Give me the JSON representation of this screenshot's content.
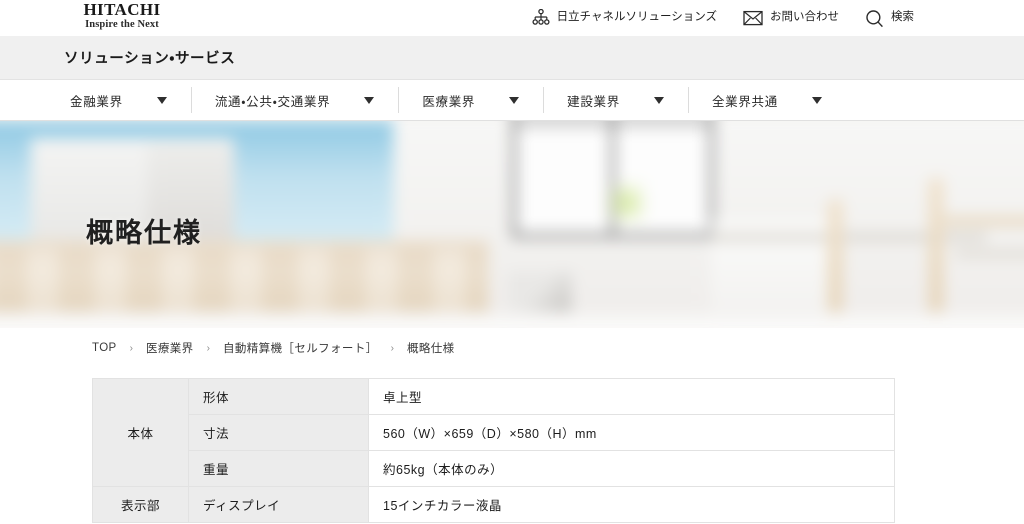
{
  "header": {
    "logo_main": "HITACHI",
    "logo_tagline": "Inspire the Next",
    "utilities": [
      {
        "icon": "sitemap-icon",
        "label": "日立チャネルソリューションズ"
      },
      {
        "icon": "mail-icon",
        "label": "お問い合わせ"
      },
      {
        "icon": "search-icon",
        "label": "検索"
      }
    ]
  },
  "title_band": {
    "title": "ソリューション・サービス"
  },
  "category_nav": {
    "items": [
      {
        "label": "金融業界"
      },
      {
        "label": "流通・公共・交通業界"
      },
      {
        "label": "医療業界"
      },
      {
        "label": "建設業界"
      },
      {
        "label": "全業界共通"
      }
    ]
  },
  "hero": {
    "title": "概略仕様"
  },
  "breadcrumb": {
    "separator": "›",
    "items": [
      {
        "label": "TOP"
      },
      {
        "label": "医療業界"
      },
      {
        "label": "自動精算機［セルフォート］"
      },
      {
        "label": "概略仕様"
      }
    ]
  },
  "spec_table": {
    "rows": [
      {
        "group": "本体",
        "group_rowspan": 3,
        "subhead": "形体",
        "value": "卓上型"
      },
      {
        "subhead": "寸法",
        "value": "560（W）×659（D）×580（H）mm"
      },
      {
        "subhead": "重量",
        "value": "約65kg（本体のみ）"
      },
      {
        "group": "表示部",
        "group_rowspan": 1,
        "subhead": "ディスプレイ",
        "value": "15インチカラー液晶"
      }
    ]
  },
  "colors": {
    "title_band_bg": "#f0f0f0",
    "table_head_bg": "#ececec",
    "border": "#e2e2e2",
    "text": "#1c1c1c",
    "hero_blue": "#9fd2e8",
    "hero_wood": "#eaddcb"
  }
}
